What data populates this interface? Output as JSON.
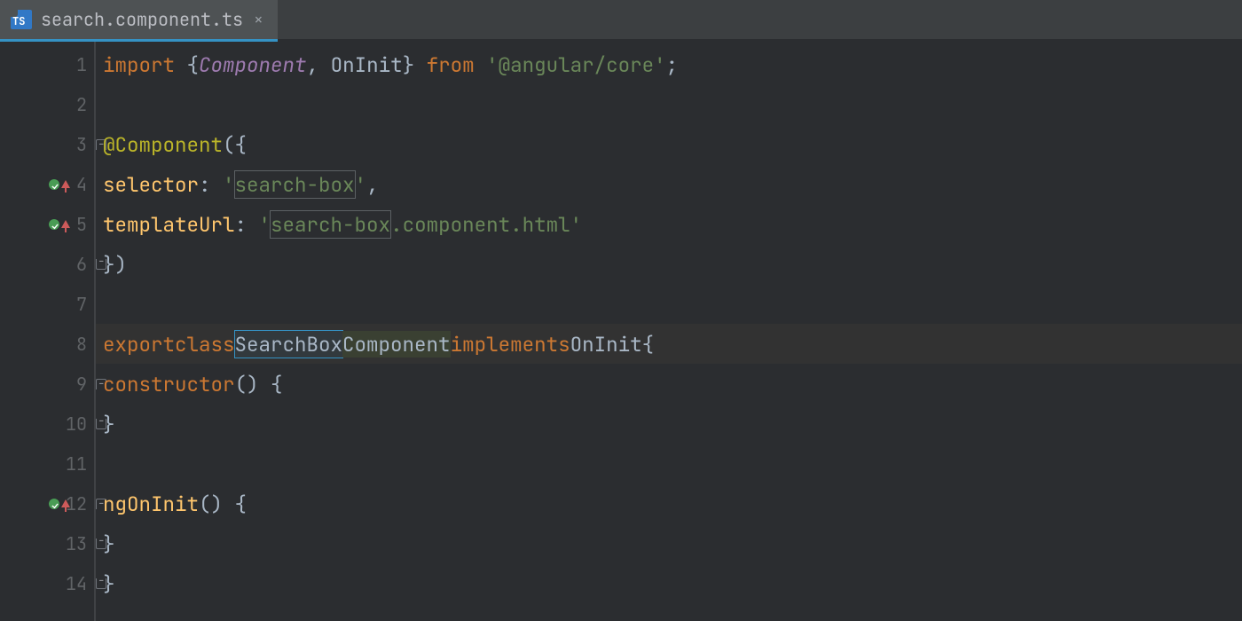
{
  "tab": {
    "filename": "search.component.ts",
    "icon_label": "TS",
    "close_glyph": "×"
  },
  "gutter": {
    "lines": [
      "1",
      "2",
      "3",
      "4",
      "5",
      "6",
      "7",
      "8",
      "9",
      "10",
      "11",
      "12",
      "13",
      "14"
    ],
    "markers": {
      "4": "override-up",
      "5": "override-up",
      "12": "override-up"
    },
    "folds": {
      "3": "top",
      "6": "bot",
      "8": "top",
      "9": "top",
      "10": "bot",
      "12": "top",
      "13": "bot",
      "14": "bot"
    }
  },
  "code": {
    "l1": {
      "kw_import": "import",
      "brace_o": " {",
      "component": "Component",
      "comma": ", ",
      "oninit": "OnInit",
      "brace_c": "} ",
      "kw_from": "from",
      "sp": " ",
      "q": "'",
      "pkg": "@angular/core",
      "semi": ";"
    },
    "l3": {
      "at": "@",
      "decor": "Component",
      "open": "({"
    },
    "l4": {
      "key": "selector",
      "colon": ": ",
      "q": "'",
      "val": "search-box",
      "comma": ","
    },
    "l5": {
      "key": "templateUrl",
      "colon": ": ",
      "q": "'",
      "val1": "search-box",
      "val2": ".component.html"
    },
    "l6": {
      "close": "})"
    },
    "l8": {
      "kw_export": "export",
      "kw_class": "class",
      "name_sel": "SearchBox",
      "name_rest": "Component",
      "kw_impl": "implements",
      "iface": "OnInit",
      "brace": "{"
    },
    "l9": {
      "ctor": "constructor",
      "rest": "() {"
    },
    "l10": {
      "brace": "}"
    },
    "l12": {
      "fn": "ngOnInit",
      "rest": "() {"
    },
    "l13": {
      "brace": "}"
    },
    "l14": {
      "brace": "}"
    }
  },
  "highlight_line": 8
}
